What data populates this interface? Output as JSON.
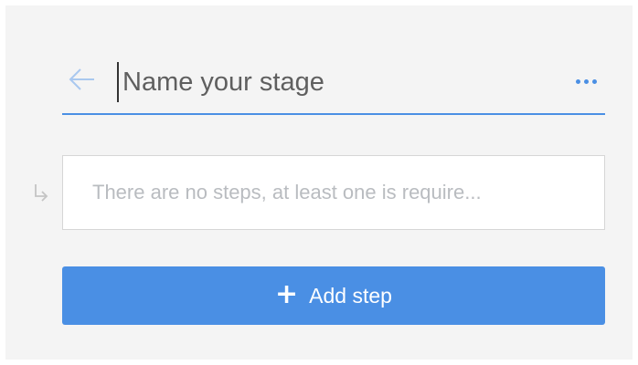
{
  "stage": {
    "name_value": "",
    "name_placeholder": "Name your stage",
    "back_icon": "arrow-left-icon",
    "more_icon": "more-horizontal-icon"
  },
  "steps": {
    "empty_message": "There are no steps, at least one is require...",
    "branch_icon": "subdirectory-arrow-icon"
  },
  "actions": {
    "add_step_icon": "+",
    "add_step_label": "Add step"
  },
  "colors": {
    "accent": "#4a8fe4",
    "panel_background": "#f4f4f4",
    "placeholder_text": "#b9bcc0",
    "title_text": "#303030"
  }
}
